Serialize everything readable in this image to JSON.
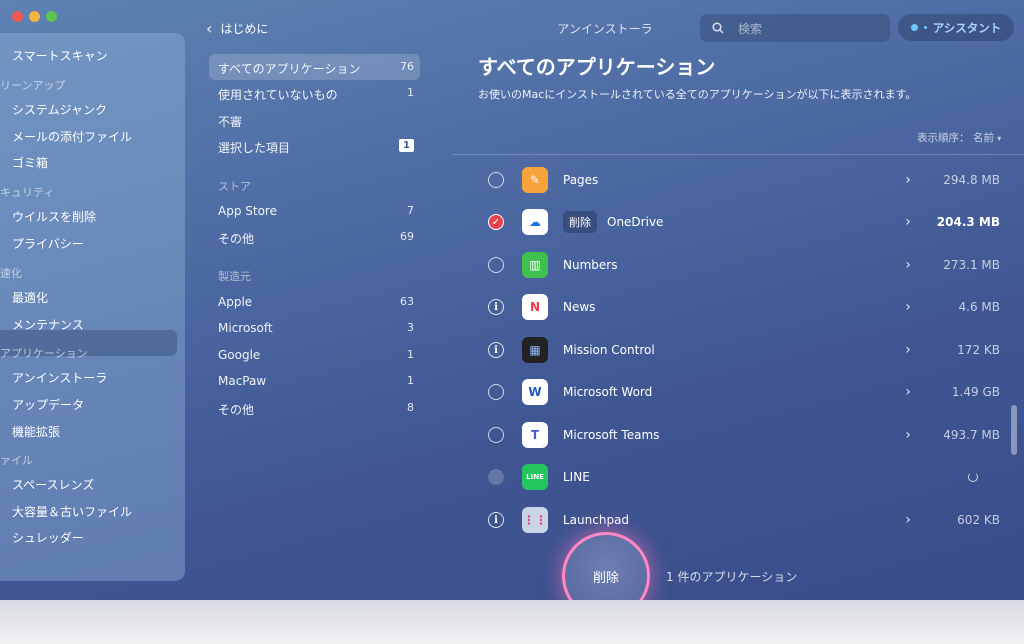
{
  "window": {
    "title": "アンインストーラ"
  },
  "sidebar": {
    "items": [
      {
        "label": "スマートスキャン",
        "type": "item"
      },
      {
        "label": "リーンアップ",
        "type": "section"
      },
      {
        "label": "システムジャンク",
        "type": "item"
      },
      {
        "label": "メールの添付ファイル",
        "type": "item"
      },
      {
        "label": "ゴミ箱",
        "type": "item"
      },
      {
        "label": "キュリティ",
        "type": "section"
      },
      {
        "label": "ウイルスを削除",
        "type": "item"
      },
      {
        "label": "プライバシー",
        "type": "item"
      },
      {
        "label": "速化",
        "type": "section"
      },
      {
        "label": "最適化",
        "type": "item"
      },
      {
        "label": "メンテナンス",
        "type": "item"
      },
      {
        "label": "アプリケーション",
        "type": "section"
      },
      {
        "label": "アンインストーラ",
        "type": "item",
        "active": true
      },
      {
        "label": "アップデータ",
        "type": "item"
      },
      {
        "label": "機能拡張",
        "type": "item"
      },
      {
        "label": "ァイル",
        "type": "section"
      },
      {
        "label": "スペースレンズ",
        "type": "item"
      },
      {
        "label": "大容量＆古いファイル",
        "type": "item"
      },
      {
        "label": "シュレッダー",
        "type": "item"
      }
    ]
  },
  "middle": {
    "back_label": "はじめに",
    "items": [
      {
        "label": "すべてのアプリケーション",
        "count": "76",
        "active": true
      },
      {
        "label": "使用されていないもの",
        "count": "1"
      },
      {
        "label": "不審",
        "count": ""
      },
      {
        "label": "選択した項目",
        "count": "1",
        "boxed": true
      }
    ],
    "store_section": "ストア",
    "store_items": [
      {
        "label": "App Store",
        "count": "7"
      },
      {
        "label": "その他",
        "count": "69"
      }
    ],
    "vendor_section": "製造元",
    "vendor_items": [
      {
        "label": "Apple",
        "count": "63"
      },
      {
        "label": "Microsoft",
        "count": "3"
      },
      {
        "label": "Google",
        "count": "1"
      },
      {
        "label": "MacPaw",
        "count": "1"
      },
      {
        "label": "その他",
        "count": "8"
      }
    ]
  },
  "header": {
    "search_placeholder": "検索",
    "assistant_label": "アシスタント"
  },
  "main": {
    "title": "すべてのアプリケーション",
    "subtitle": "お使いのMacにインストールされている全てのアプリケーションが以下に表示されます。",
    "sort_label": "表示順序：",
    "sort_value": "名前",
    "apps": [
      {
        "name": "Pages",
        "size": "294.8 MB",
        "state": "unchecked",
        "icon": "pages-icon",
        "color": "#f7a23a"
      },
      {
        "name": "OneDrive",
        "size": "204.3 MB",
        "state": "checked",
        "action": "削除",
        "icon": "onedrive-icon",
        "color": "#ffffff"
      },
      {
        "name": "Numbers",
        "size": "273.1 MB",
        "state": "unchecked",
        "icon": "numbers-icon",
        "color": "#3fc04f"
      },
      {
        "name": "News",
        "size": "4.6 MB",
        "state": "info",
        "icon": "news-icon",
        "color": "#ffffff"
      },
      {
        "name": "Mission Control",
        "size": "172 KB",
        "state": "info",
        "icon": "mission-control-icon",
        "color": "#222222"
      },
      {
        "name": "Microsoft Word",
        "size": "1.49 GB",
        "state": "unchecked",
        "icon": "word-icon",
        "color": "#ffffff"
      },
      {
        "name": "Microsoft Teams",
        "size": "493.7 MB",
        "state": "unchecked",
        "icon": "teams-icon",
        "color": "#ffffff"
      },
      {
        "name": "LINE",
        "size": "",
        "state": "disabled",
        "loading": true,
        "icon": "line-icon",
        "color": "#22c55e"
      },
      {
        "name": "Launchpad",
        "size": "602 KB",
        "state": "info",
        "icon": "launchpad-icon",
        "color": "#c9d4e6"
      }
    ]
  },
  "footer": {
    "delete_label": "削除",
    "count_label": "1 件のアプリケーション"
  }
}
